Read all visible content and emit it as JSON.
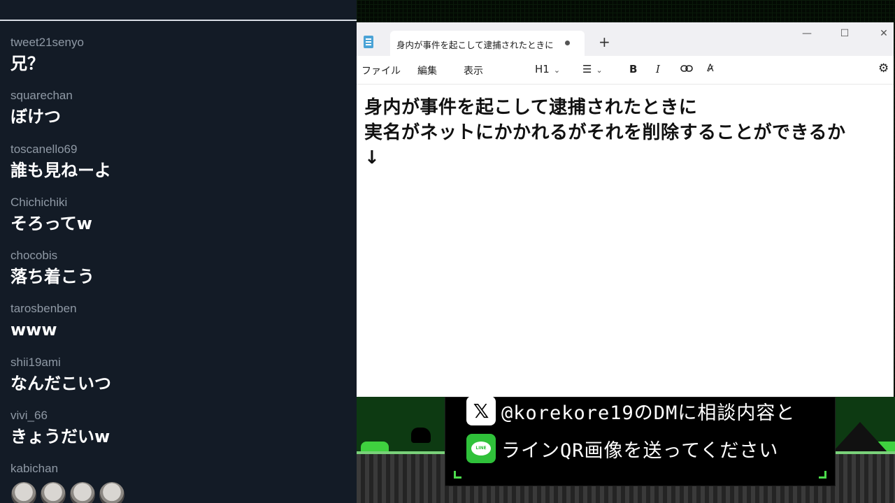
{
  "chat": {
    "messages": [
      {
        "user": "tweet21senyo",
        "text": "兄？"
      },
      {
        "user": "squarechan",
        "text": "ぼけつ"
      },
      {
        "user": "toscanello69",
        "text": "誰も見ねーよ"
      },
      {
        "user": "Chichichiki",
        "text": "そろってw"
      },
      {
        "user": "chocobis",
        "text": "落ち着こう"
      },
      {
        "user": "tarosbenben",
        "text": "www"
      },
      {
        "user": "shii19ami",
        "text": "なんだこいつ"
      },
      {
        "user": "vivi_66",
        "text": "きょうだいw"
      },
      {
        "user": "kabichan",
        "text": ""
      }
    ],
    "emote_icons": [
      "face-emote-icon",
      "face-emote-icon",
      "face-emote-icon",
      "face-emote-icon"
    ]
  },
  "notepad": {
    "tab_title": "身内が事件を起こして逮捕されたときに",
    "new_tab": "+",
    "window_controls": {
      "minimize": "—",
      "maximize": "☐",
      "close": "✕"
    },
    "menus": [
      "ファイル",
      "編集",
      "表示"
    ],
    "toolbar": {
      "heading": "H1",
      "list_icon": "list-icon",
      "bold": "B",
      "italic": "I",
      "link_icon": "link-icon",
      "clear_format_icon": "clear-format-icon",
      "settings_icon": "gear-icon"
    },
    "lines": [
      "身内が事件を起こして逮捕されたときに",
      "実名がネットにかかれるがそれを削除することができるか",
      "↓"
    ]
  },
  "overlay": {
    "line1": "@korekore19のDMに相談内容と",
    "line2": "ラインQR画像を送ってください",
    "x_icon": "x-logo-icon",
    "line_icon": "line-app-icon",
    "accent": "#4cdc4c"
  }
}
